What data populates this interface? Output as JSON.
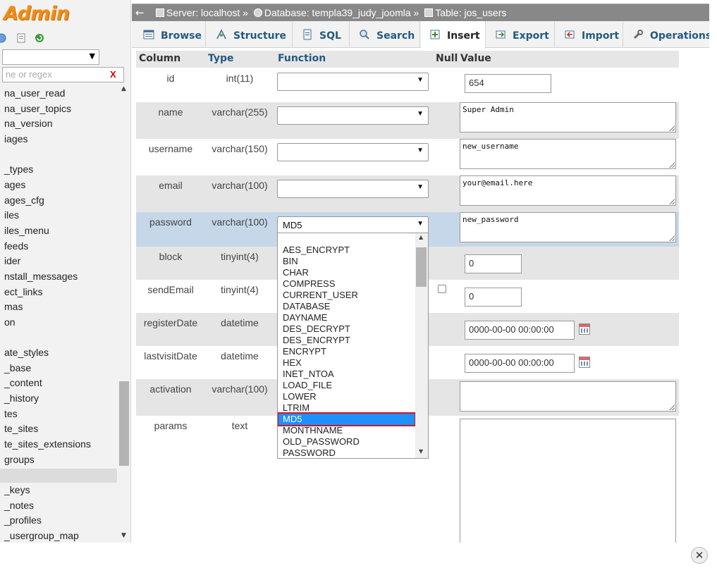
{
  "app": {
    "logo_text": "Admin"
  },
  "sidebar": {
    "db_select_value": "",
    "filter_placeholder": "ne or regex",
    "filter_clear": "X",
    "items": [
      "na_user_read",
      "na_user_topics",
      "na_version",
      "iages",
      "",
      "_types",
      "ages",
      "ages_cfg",
      "iles",
      "iles_menu",
      "feeds",
      "ider",
      "nstall_messages",
      "ect_links",
      "mas",
      "on",
      "",
      "ate_styles",
      "_base",
      "_content",
      "_history",
      "tes",
      "te_sites",
      "te_sites_extensions",
      "groups",
      "",
      "_keys",
      "_notes",
      "_profiles",
      "_usergroup_map"
    ]
  },
  "breadcrumb": {
    "server": "Server: localhost »",
    "database": "Database: templa39_judy_joomla »",
    "table": "Table: jos_users"
  },
  "tabs": [
    "Browse",
    "Structure",
    "SQL",
    "Search",
    "Insert",
    "Export",
    "Import",
    "Operations"
  ],
  "active_tab": "Insert",
  "form": {
    "headers": {
      "column": "Column",
      "type": "Type",
      "function": "Function",
      "null": "Null",
      "value": "Value"
    },
    "rows": [
      {
        "name": "id",
        "type": "int(11)",
        "function": "",
        "value": "654"
      },
      {
        "name": "name",
        "type": "varchar(255)",
        "function": "",
        "value": "Super Admin"
      },
      {
        "name": "username",
        "type": "varchar(150)",
        "function": "",
        "value": "new_username"
      },
      {
        "name": "email",
        "type": "varchar(100)",
        "function": "",
        "value": "your@email.here"
      },
      {
        "name": "password",
        "type": "varchar(100)",
        "function": "MD5",
        "value": "new_password"
      },
      {
        "name": "block",
        "type": "tinyint(4)",
        "value": "0"
      },
      {
        "name": "sendEmail",
        "type": "tinyint(4)",
        "value": "0"
      },
      {
        "name": "registerDate",
        "type": "datetime",
        "value": "0000-00-00 00:00:00"
      },
      {
        "name": "lastvisitDate",
        "type": "datetime",
        "value": "0000-00-00 00:00:00"
      },
      {
        "name": "activation",
        "type": "varchar(100)",
        "value": ""
      },
      {
        "name": "params",
        "type": "text",
        "value": ""
      }
    ]
  },
  "dropdown": {
    "options": [
      "AES_ENCRYPT",
      "BIN",
      "CHAR",
      "COMPRESS",
      "CURRENT_USER",
      "DATABASE",
      "DAYNAME",
      "DES_DECRYPT",
      "DES_ENCRYPT",
      "ENCRYPT",
      "HEX",
      "INET_NTOA",
      "LOAD_FILE",
      "LOWER",
      "LTRIM",
      "MD5",
      "MONTHNAME",
      "OLD_PASSWORD",
      "PASSWORD"
    ],
    "selected": "MD5"
  },
  "colors": {
    "logo": "#f28c16",
    "tab_text": "#235a81",
    "selection": "#1e90ff",
    "highlight_border": "#d4141c",
    "row_highlight": "#c5d7e8"
  },
  "close_label": "✕"
}
